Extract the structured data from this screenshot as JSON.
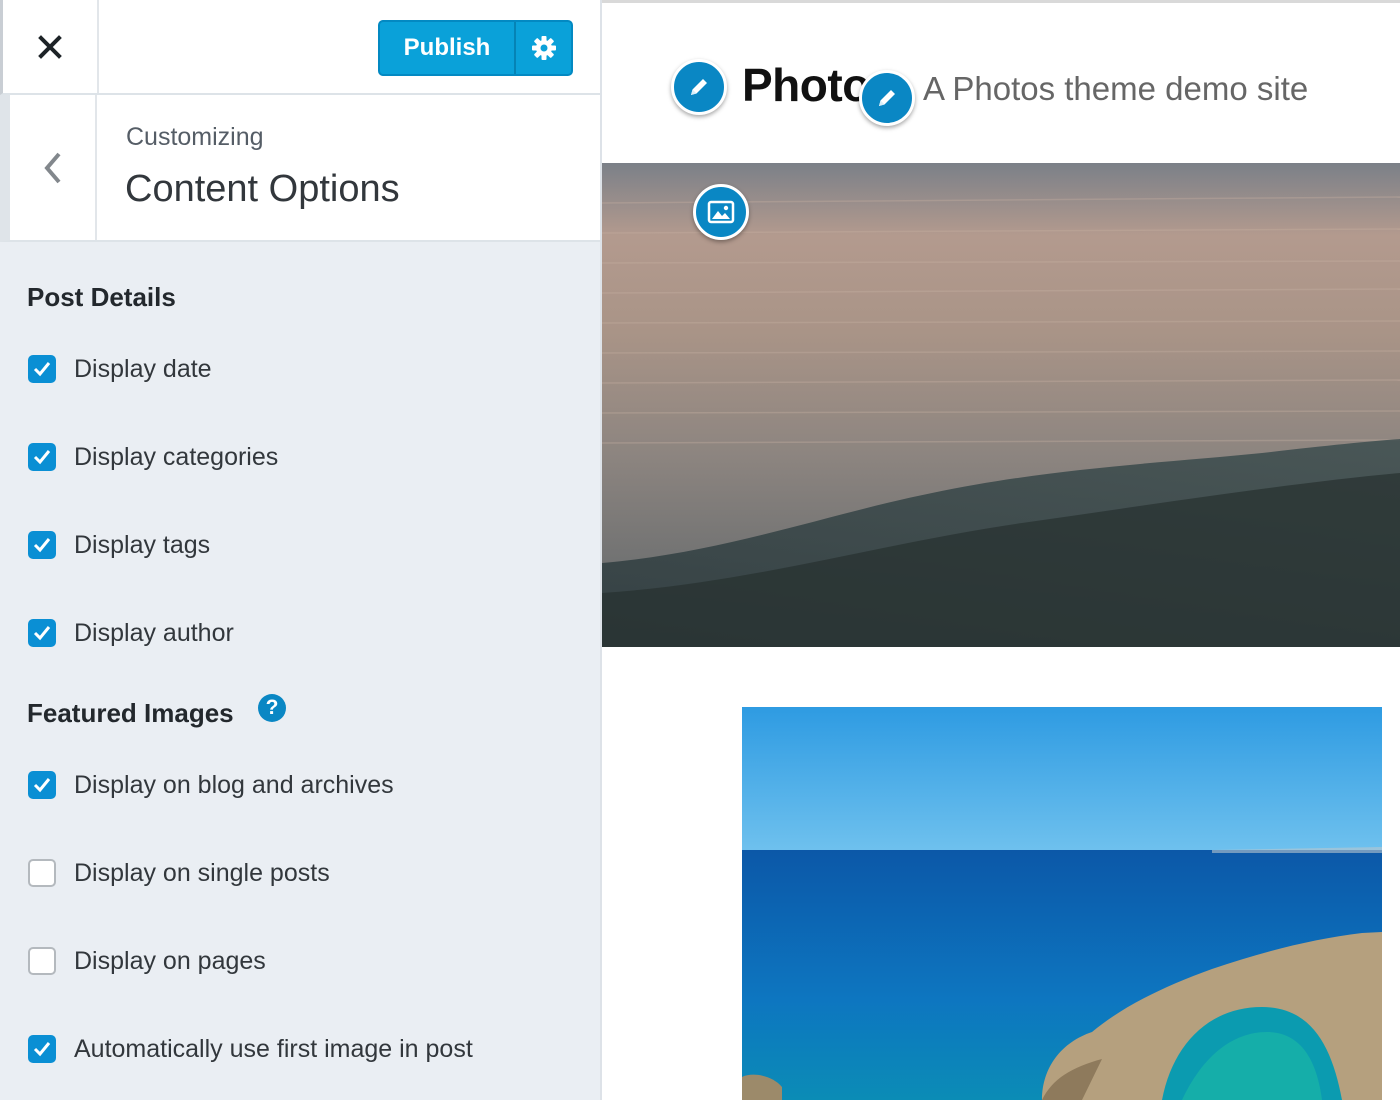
{
  "customizer": {
    "close_icon": "close-icon",
    "publish_label": "Publish",
    "settings_icon": "gear-icon",
    "back_icon": "chevron-left-icon",
    "customizing_label": "Customizing",
    "section_title": "Content Options",
    "colors": {
      "accent": "#0a8fd4",
      "panel_bg": "#eaeef3"
    }
  },
  "post_details": {
    "heading": "Post Details",
    "options": [
      {
        "label": "Display date",
        "checked": true
      },
      {
        "label": "Display categories",
        "checked": true
      },
      {
        "label": "Display tags",
        "checked": true
      },
      {
        "label": "Display author",
        "checked": true
      }
    ]
  },
  "featured_images": {
    "heading": "Featured Images",
    "help_glyph": "?",
    "options": [
      {
        "label": "Display on blog and archives",
        "checked": true
      },
      {
        "label": "Display on single posts",
        "checked": false
      },
      {
        "label": "Display on pages",
        "checked": false
      },
      {
        "label": "Automatically use first image in post",
        "checked": true
      }
    ]
  },
  "preview": {
    "site_title": "Photo",
    "tagline": "A Photos theme demo site",
    "shortcut_icons": [
      "pencil-icon",
      "pencil-icon",
      "image-icon"
    ]
  }
}
